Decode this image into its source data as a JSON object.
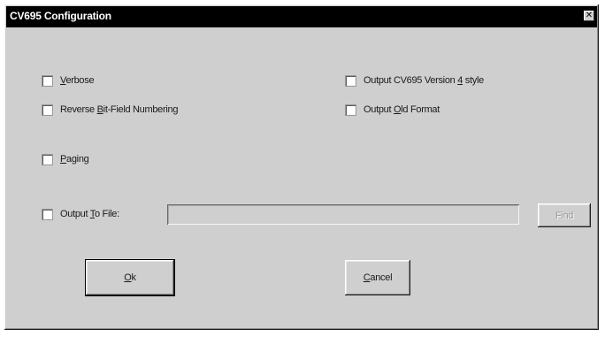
{
  "window": {
    "title": "CV695 Configuration",
    "close_glyph": "✕"
  },
  "options": {
    "verbose": {
      "label_pre": "",
      "mnemonic": "V",
      "label_post": "erbose",
      "checked": false
    },
    "reverse_bitfield": {
      "label_pre": "Reverse ",
      "mnemonic": "B",
      "label_post": "it-Field Numbering",
      "checked": false
    },
    "paging": {
      "label_pre": "",
      "mnemonic": "P",
      "label_post": "aging",
      "checked": false
    },
    "output_cv695_v4": {
      "label_pre": "Output CV695 Version ",
      "mnemonic": "4",
      "label_post": " style",
      "checked": false
    },
    "output_old_format": {
      "label_pre": "Output ",
      "mnemonic": "O",
      "label_post": "ld Format",
      "checked": false
    },
    "output_to_file": {
      "label_pre": "Output ",
      "mnemonic": "T",
      "label_post": "o File:",
      "checked": false
    }
  },
  "file_field": {
    "value": "",
    "browse_label": "Find"
  },
  "buttons": {
    "ok": {
      "mnemonic": "O",
      "label_post": "k"
    },
    "cancel": {
      "mnemonic": "C",
      "label_post": "ancel"
    }
  },
  "icons": {
    "close": "close-icon",
    "checkbox": "checkbox-unchecked"
  },
  "colors": {
    "titlebar": "#000000",
    "dialog_face": "#cfcfcf",
    "checkbox_fill": "#ffffff",
    "disabled_text": "#9a9a9a"
  }
}
